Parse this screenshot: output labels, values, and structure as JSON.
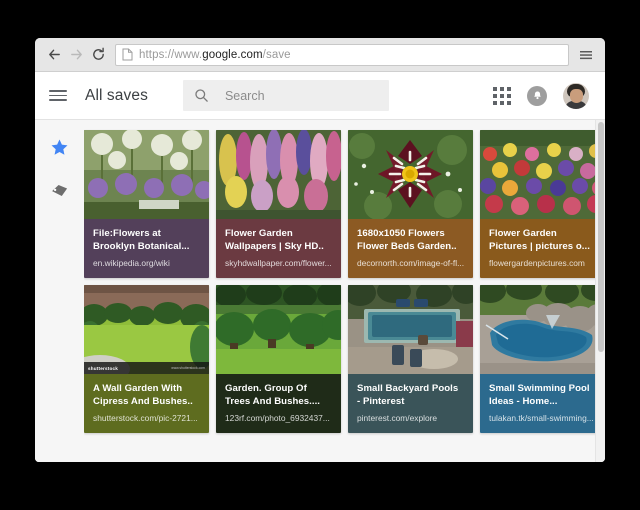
{
  "browser": {
    "back_icon": "back-arrow-icon",
    "forward_icon": "forward-arrow-icon",
    "reload_icon": "reload-icon",
    "menu_icon": "chrome-menu-icon",
    "page_icon": "page-document-icon",
    "url_scheme": "https://www.",
    "url_host": "google.com",
    "url_path": "/save",
    "url_full": "https://www.google.com/save"
  },
  "header": {
    "menu_icon": "hamburger-menu-icon",
    "title": "All saves",
    "search_placeholder": "Search",
    "search_icon": "search-icon",
    "apps_icon": "apps-grid-icon",
    "notification_icon": "notification-bell-icon",
    "avatar_icon": "user-avatar"
  },
  "sidebar": {
    "items": [
      {
        "name": "star-icon",
        "label": "Saves",
        "color": "#4285f4"
      },
      {
        "name": "tag-icon",
        "label": "Labels",
        "color": "#737373"
      }
    ]
  },
  "cards": [
    {
      "title": "File:Flowers at Brooklyn Botanical...",
      "url": "en.wikipedia.org/wiki",
      "color": "#53405a",
      "thumb": "alliums-purple-globes",
      "watermark": null
    },
    {
      "title": "Flower Garden Wallpapers | Sky HD..",
      "url": "skyhdwallpaper.com/flower...",
      "color": "#6b3a41",
      "thumb": "lupines-pink-yellow-field",
      "watermark": null
    },
    {
      "title": "1680x1050 Flowers Flower Beds Garden..",
      "url": "decornorth.com/image-of-fl...",
      "color": "#8c5a23",
      "thumb": "dark-red-dahlia-closeup",
      "watermark": null
    },
    {
      "title": "Flower Garden Pictures | pictures o...",
      "url": "flowergardenpictures.com",
      "color": "#8a5a1c",
      "thumb": "mixed-flowerbed-colors",
      "watermark": null
    },
    {
      "title": "A Wall Garden With Cipress And Bushes..",
      "url": "shutterstock.com/pic-2721...",
      "color": "#5e6c1f",
      "thumb": "green-lawn-walled-garden",
      "watermark": {
        "left": "shutterstock",
        "right": "www.shutterstock.com"
      }
    },
    {
      "title": "Garden. Group Of Trees And Bushes....",
      "url": "123rf.com/photo_6932437...",
      "color": "#1f2b18",
      "thumb": "trimmed-round-bushes",
      "watermark": null
    },
    {
      "title": "Small Backyard Pools - Pinterest",
      "url": "pinterest.com/explore",
      "color": "#3a5459",
      "thumb": "rectangular-pool-patio",
      "watermark": null
    },
    {
      "title": "Small Swimming Pool Ideas - Home...",
      "url": "tulakan.tk/small-swimming...",
      "color": "#2c6a8e",
      "thumb": "kidney-pool-rock-waterfall",
      "watermark": null
    }
  ]
}
